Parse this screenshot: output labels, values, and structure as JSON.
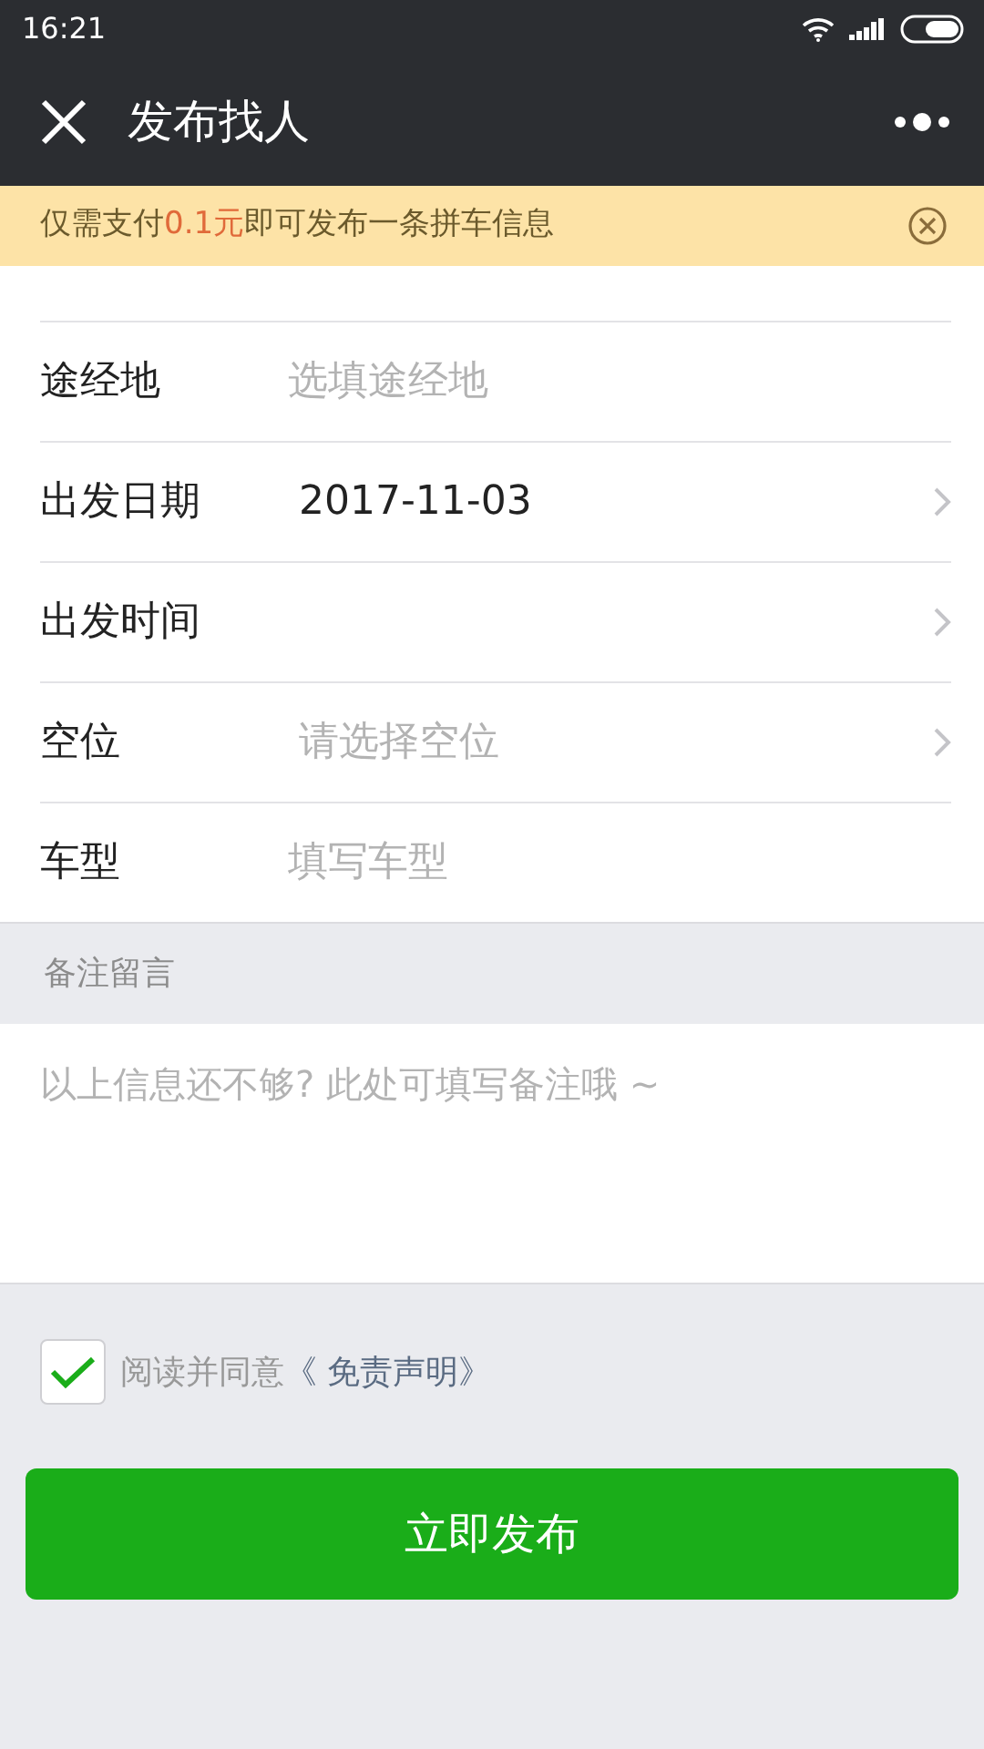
{
  "status_bar": {
    "time": "16:21"
  },
  "title_bar": {
    "title": "发布找人"
  },
  "notice": {
    "text": "仅需支付**0.1元**即可发布一条拼车信息"
  },
  "form_rows": [
    {
      "kind": "input",
      "label": "途经地",
      "placeholder": "选填途经地"
    },
    {
      "kind": "picker",
      "label": "出发日期",
      "value": "2017-11-03"
    },
    {
      "kind": "picker",
      "label": "出发时间"
    },
    {
      "kind": "picker",
      "label": "空位",
      "placeholder": "请选择空位"
    },
    {
      "kind": "input",
      "label": "车型",
      "placeholder": "填写车型"
    }
  ],
  "remarks": {
    "heading": "备注留言",
    "placeholder": "以上信息还不够? 此处可填写备注哦 ~"
  },
  "agreement": {
    "checked": true,
    "text": "阅读并同意",
    "link": "《 免责声明》"
  },
  "submit_button": "立即发布"
}
